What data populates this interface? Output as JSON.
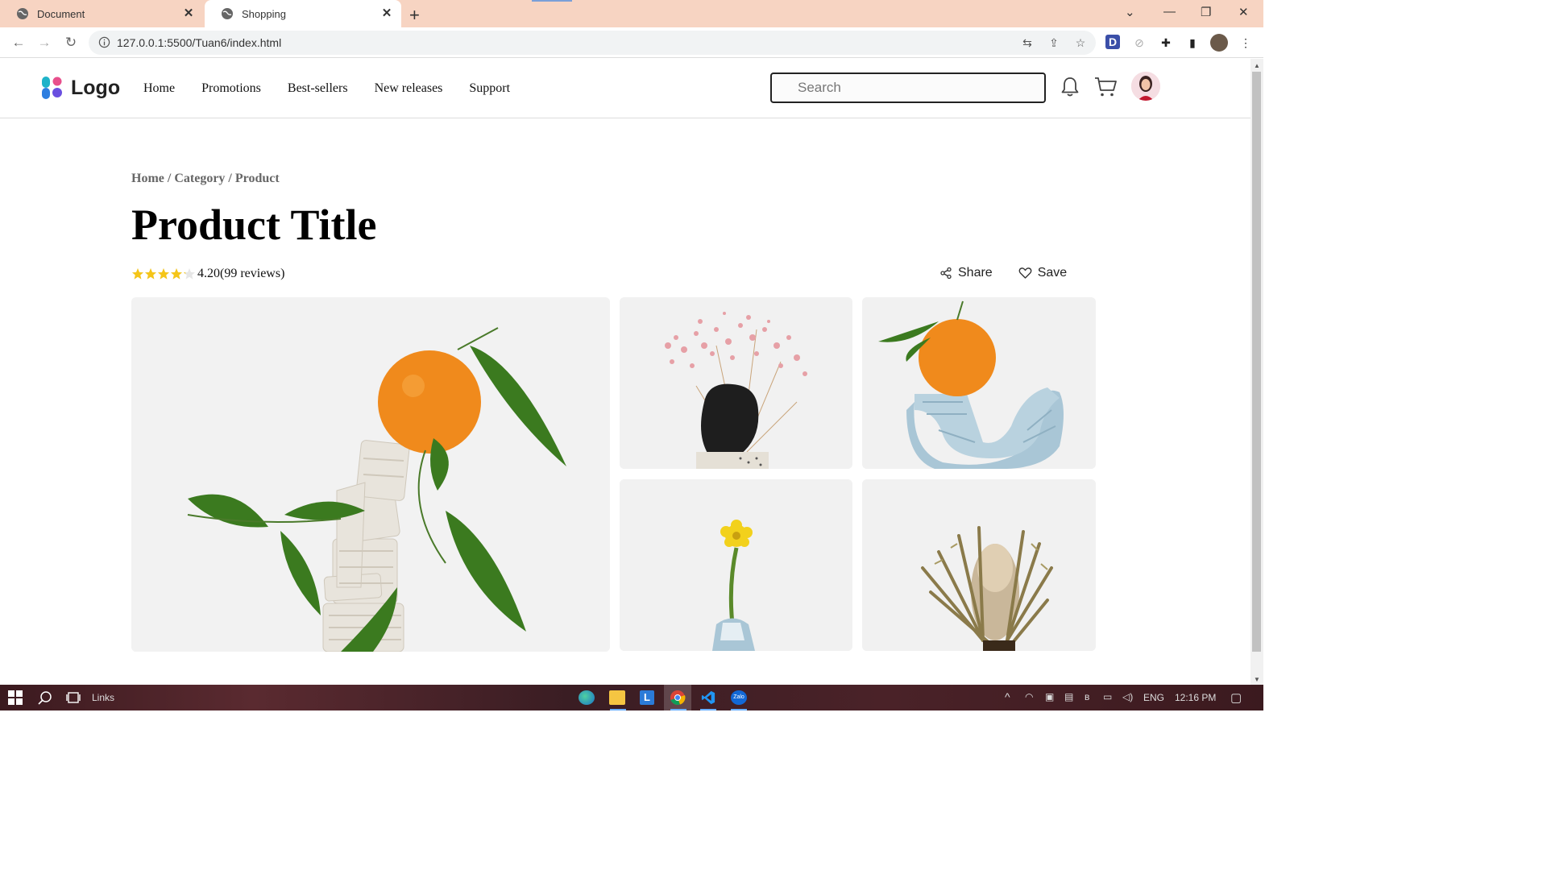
{
  "browser": {
    "tabs": [
      {
        "title": "Document",
        "active": false
      },
      {
        "title": "Shopping",
        "active": true
      }
    ],
    "url": "127.0.0.1:5500/Tuan6/index.html"
  },
  "header": {
    "logo_text": "Logo",
    "nav": [
      "Home",
      "Promotions",
      "Best-sellers",
      "New releases",
      "Support"
    ],
    "search_placeholder": "Search"
  },
  "product": {
    "breadcrumb": [
      "Home",
      "Category",
      "Product"
    ],
    "breadcrumb_sep": " / ",
    "title": "Product Title",
    "rating_value": "4.20",
    "reviews_text": "(99 reviews)",
    "rating_stars": 4.2,
    "share_label": "Share",
    "save_label": "Save"
  },
  "taskbar": {
    "links_label": "Links",
    "lang": "ENG",
    "time": "12:16 PM"
  },
  "colors": {
    "tabbar_bg": "#f7d4c2",
    "star": "#f5c518",
    "orange": "#f08a1c",
    "leaf": "#3b7a1f"
  }
}
